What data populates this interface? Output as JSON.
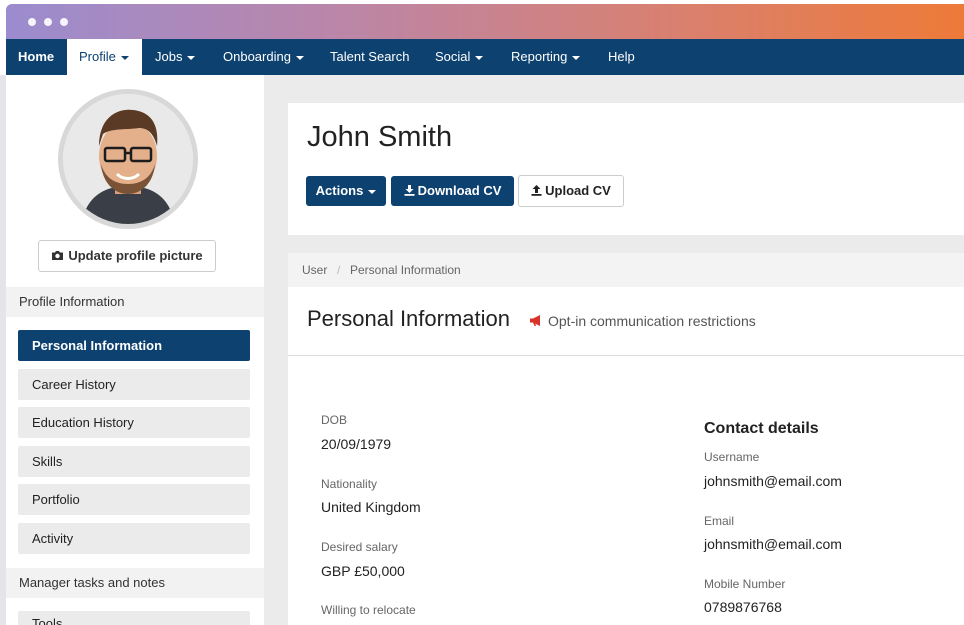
{
  "nav": {
    "home": "Home",
    "profile": "Profile",
    "jobs": "Jobs",
    "onboarding": "Onboarding",
    "talent_search": "Talent Search",
    "social": "Social",
    "reporting": "Reporting",
    "help": "Help"
  },
  "sidebar": {
    "update_picture": "Update profile picture",
    "section_profile": "Profile Information",
    "items": [
      "Personal Information",
      "Career History",
      "Education History",
      "Skills",
      "Portfolio",
      "Activity"
    ],
    "section_manager": "Manager tasks and notes",
    "partial_item": "Tools"
  },
  "header": {
    "name": "John Smith",
    "actions": "Actions",
    "download_cv": "Download CV",
    "upload_cv": "Upload CV"
  },
  "breadcrumb": {
    "root": "User",
    "sep": "/",
    "current": "Personal Information"
  },
  "page": {
    "title": "Personal Information",
    "optin": "Opt-in communication restrictions"
  },
  "personal": {
    "dob_label": "DOB",
    "dob": "20/09/1979",
    "nationality_label": "Nationality",
    "nationality": "United Kingdom",
    "salary_label": "Desired salary",
    "salary": "GBP £50,000",
    "relocate_label": "Willing to relocate"
  },
  "contact": {
    "heading": "Contact details",
    "username_label": "Username",
    "username": "johnsmith@email.com",
    "email_label": "Email",
    "email": "johnsmith@email.com",
    "mobile_label": "Mobile Number",
    "mobile": "0789876768"
  },
  "colors": {
    "nav": "#0c4170",
    "accent": "#0c4170",
    "optin_icon": "#d9322b"
  }
}
